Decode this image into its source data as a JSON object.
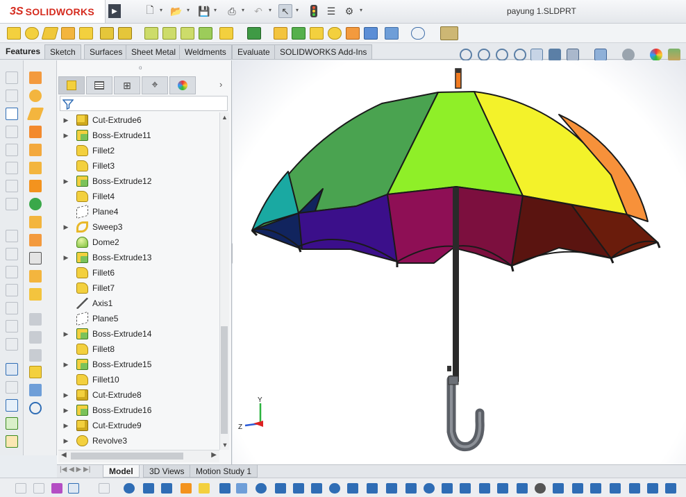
{
  "app": {
    "logo_ds": "3S",
    "logo_name": "SOLIDWORKS",
    "document_title": "payung 1.SLDPRT"
  },
  "command_tabs": [
    {
      "label": "Features",
      "active": true
    },
    {
      "label": "Sketch",
      "active": false
    },
    {
      "label": "Surfaces",
      "active": false
    },
    {
      "label": "Sheet Metal",
      "active": false
    },
    {
      "label": "Weldments",
      "active": false
    },
    {
      "label": "Evaluate",
      "active": false
    },
    {
      "label": "SOLIDWORKS Add-Ins",
      "active": false
    }
  ],
  "feature_tree": {
    "items": [
      {
        "label": "Cut-Extrude6",
        "icon": "cut-extrude-icon",
        "expandable": true
      },
      {
        "label": "Boss-Extrude11",
        "icon": "boss-extrude-icon",
        "expandable": true
      },
      {
        "label": "Fillet2",
        "icon": "fillet-icon",
        "expandable": false
      },
      {
        "label": "Fillet3",
        "icon": "fillet-icon",
        "expandable": false
      },
      {
        "label": "Boss-Extrude12",
        "icon": "boss-extrude-icon",
        "expandable": true
      },
      {
        "label": "Fillet4",
        "icon": "fillet-icon",
        "expandable": false
      },
      {
        "label": "Plane4",
        "icon": "plane-icon",
        "expandable": false
      },
      {
        "label": "Sweep3",
        "icon": "sweep-icon",
        "expandable": true
      },
      {
        "label": "Dome2",
        "icon": "dome-icon",
        "expandable": false
      },
      {
        "label": "Boss-Extrude13",
        "icon": "boss-extrude-icon",
        "expandable": true
      },
      {
        "label": "Fillet6",
        "icon": "fillet-icon",
        "expandable": false
      },
      {
        "label": "Fillet7",
        "icon": "fillet-icon",
        "expandable": false
      },
      {
        "label": "Axis1",
        "icon": "axis-icon",
        "expandable": false
      },
      {
        "label": "Plane5",
        "icon": "plane-icon",
        "expandable": false
      },
      {
        "label": "Boss-Extrude14",
        "icon": "boss-extrude-icon",
        "expandable": true
      },
      {
        "label": "Fillet8",
        "icon": "fillet-icon",
        "expandable": false
      },
      {
        "label": "Boss-Extrude15",
        "icon": "boss-extrude-icon",
        "expandable": true
      },
      {
        "label": "Fillet10",
        "icon": "fillet-icon",
        "expandable": false
      },
      {
        "label": "Cut-Extrude8",
        "icon": "cut-extrude-icon",
        "expandable": true
      },
      {
        "label": "Boss-Extrude16",
        "icon": "boss-extrude-icon",
        "expandable": true
      },
      {
        "label": "Cut-Extrude9",
        "icon": "cut-extrude-icon",
        "expandable": true
      },
      {
        "label": "Revolve3",
        "icon": "revolve-icon",
        "expandable": true
      }
    ]
  },
  "bottom_tabs": [
    {
      "label": "Model",
      "active": true
    },
    {
      "label": "3D Views",
      "active": false
    },
    {
      "label": "Motion Study 1",
      "active": false
    }
  ],
  "triad": {
    "x": "",
    "y": "Y",
    "z": "Z"
  },
  "colors": {
    "feature_yellow": "#f3d03e",
    "feature_green": "#8fbf3c",
    "accent_blue": "#2f6db5",
    "logo_red": "#d52b1e"
  }
}
